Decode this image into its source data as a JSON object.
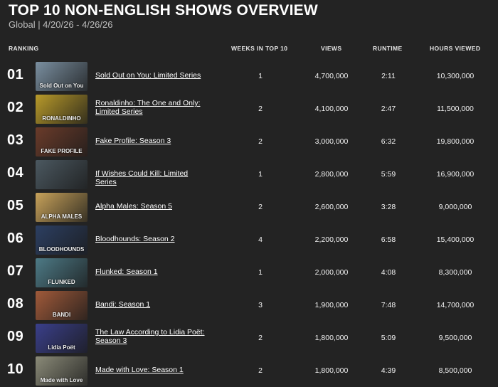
{
  "header": {
    "title": "TOP 10 NON-ENGLISH SHOWS OVERVIEW",
    "subtitle": "Global | 4/20/26 - 4/26/26"
  },
  "columns": {
    "ranking": "RANKING",
    "weeks": "WEEKS IN TOP 10",
    "views": "VIEWS",
    "runtime": "RUNTIME",
    "hours": "HOURS VIEWED"
  },
  "colors": {
    "background": "#232323",
    "text": "#ffffff"
  },
  "rows": [
    {
      "rank": "01",
      "title": "Sold Out on You: Limited Series",
      "weeks": "1",
      "views": "4,700,000",
      "runtime": "2:11",
      "hours": "10,300,000",
      "thumb_text": "Sold Out on You",
      "thumb_color": "#7a8fa0"
    },
    {
      "rank": "02",
      "title": "Ronaldinho: The One and Only: Limited Series",
      "weeks": "2",
      "views": "4,100,000",
      "runtime": "2:47",
      "hours": "11,500,000",
      "thumb_text": "RONALDINHO",
      "thumb_color": "#b89a2a"
    },
    {
      "rank": "03",
      "title": "Fake Profile: Season 3",
      "weeks": "2",
      "views": "3,000,000",
      "runtime": "6:32",
      "hours": "19,800,000",
      "thumb_text": "FAKE PROFILE",
      "thumb_color": "#6a3b2a"
    },
    {
      "rank": "04",
      "title": "If Wishes Could Kill: Limited Series",
      "weeks": "1",
      "views": "2,800,000",
      "runtime": "5:59",
      "hours": "16,900,000",
      "thumb_text": "",
      "thumb_color": "#4b5860"
    },
    {
      "rank": "05",
      "title": "Alpha Males: Season 5",
      "weeks": "2",
      "views": "2,600,000",
      "runtime": "3:28",
      "hours": "9,000,000",
      "thumb_text": "ALPHA MALES",
      "thumb_color": "#c7a25a"
    },
    {
      "rank": "06",
      "title": "Bloodhounds: Season 2",
      "weeks": "4",
      "views": "2,200,000",
      "runtime": "6:58",
      "hours": "15,400,000",
      "thumb_text": "BLOODHOUNDS",
      "thumb_color": "#2c3f62"
    },
    {
      "rank": "07",
      "title": "Flunked: Season 1",
      "weeks": "1",
      "views": "2,000,000",
      "runtime": "4:08",
      "hours": "8,300,000",
      "thumb_text": "FLUNKED",
      "thumb_color": "#4d7a86"
    },
    {
      "rank": "08",
      "title": "Bandi: Season 1",
      "weeks": "3",
      "views": "1,900,000",
      "runtime": "7:48",
      "hours": "14,700,000",
      "thumb_text": "BANDI",
      "thumb_color": "#a05a3a"
    },
    {
      "rank": "09",
      "title": "The Law According to Lidia Poët: Season 3",
      "weeks": "2",
      "views": "1,800,000",
      "runtime": "5:09",
      "hours": "9,500,000",
      "thumb_text": "Lidia Poët",
      "thumb_color": "#3a3f8a"
    },
    {
      "rank": "10",
      "title": "Made with Love: Season 1",
      "weeks": "2",
      "views": "1,800,000",
      "runtime": "4:39",
      "hours": "8,500,000",
      "thumb_text": "Made with Love",
      "thumb_color": "#8a8a78"
    }
  ]
}
